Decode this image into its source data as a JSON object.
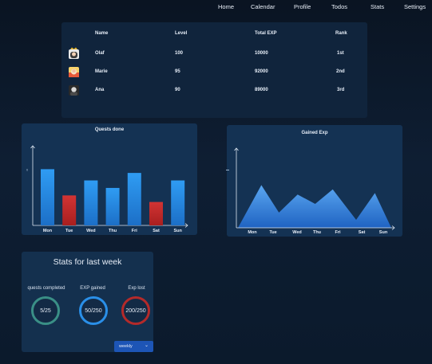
{
  "nav": {
    "items": [
      "Home",
      "Calendar",
      "Profile",
      "Todos",
      "Stats",
      "Settings"
    ]
  },
  "leaderboard": {
    "headers": {
      "name": "Name",
      "level": "Level",
      "exp": "Total EXP",
      "rank": "Rank"
    },
    "rows": [
      {
        "name": "Olaf",
        "level": "100",
        "exp": "10000",
        "rank": "1st"
      },
      {
        "name": "Marie",
        "level": "95",
        "exp": "92000",
        "rank": "2nd"
      },
      {
        "name": "Ana",
        "level": "90",
        "exp": "89000",
        "rank": "3rd"
      }
    ]
  },
  "chart_data": [
    {
      "type": "bar",
      "title": "Quests done",
      "categories": [
        "Mon",
        "Tue",
        "Wed",
        "Thu",
        "Fri",
        "Sat",
        "Sun"
      ],
      "values": [
        6,
        3.2,
        4.8,
        4,
        5.6,
        2.5,
        4.8
      ],
      "bar_colors": [
        "#2a8fe8",
        "#c12b2b",
        "#2a8fe8",
        "#2a8fe8",
        "#2a8fe8",
        "#c12b2b",
        "#2a8fe8"
      ],
      "ytick_label": "6",
      "ylim": [
        0,
        8.5
      ],
      "grid": false
    },
    {
      "type": "area",
      "title": "Gained Exp",
      "categories": [
        "Mon",
        "Tue",
        "Wed",
        "Thu",
        "Fri",
        "Sat",
        "Sun"
      ],
      "x": [
        0,
        1,
        1.75,
        2.55,
        3.3,
        4.05,
        5.05,
        5.85,
        6.55
      ],
      "values": [
        0,
        5.9,
        2.1,
        4.6,
        3.3,
        5.3,
        1.1,
        4.8,
        0
      ],
      "color": "#3f8fe6",
      "ylim": [
        0,
        11
      ],
      "grid": false
    }
  ],
  "stats": {
    "title": "Stats for last week",
    "items": [
      {
        "label": "quests completed",
        "value": "5/25",
        "color": "#3a8f86"
      },
      {
        "label": "EXP gained",
        "value": "50/250",
        "color": "#2a8fe8"
      },
      {
        "label": "Exp lost",
        "value": "200/250",
        "color": "#b42a2a"
      }
    ],
    "period": "weekly"
  }
}
